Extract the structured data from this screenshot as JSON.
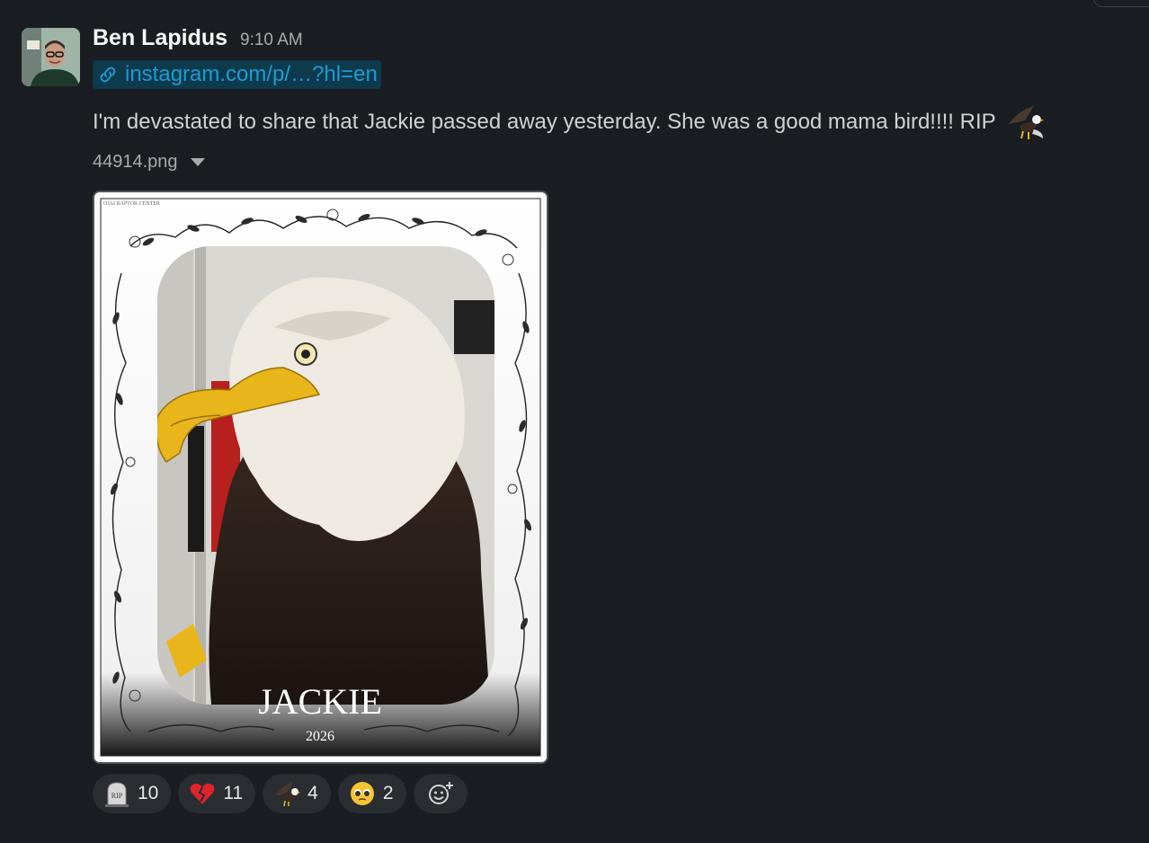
{
  "message": {
    "author": "Ben Lapidus",
    "time": "9:10 AM",
    "link_text": "instagram.com/p/…?hl=en",
    "body": "I'm devastated to share that Jackie passed away yesterday. She was a good mama bird!!!! RIP",
    "body_emoji": "eagle-emoji"
  },
  "attachment": {
    "file_name": "44914.png",
    "corner_caption": "OJAI RAPTOR CENTER",
    "caption_name": "JACKIE",
    "caption_year": "2026"
  },
  "reactions": [
    {
      "emoji": "headstone-rip",
      "count": "10"
    },
    {
      "emoji": "broken-heart",
      "count": "11"
    },
    {
      "emoji": "eagle",
      "count": "4"
    },
    {
      "emoji": "pleading-face",
      "count": "2"
    }
  ],
  "colors": {
    "background": "#1a1d21",
    "link": "#1d9bd1",
    "link_bg": "#0e3a4d",
    "reaction_bg": "#2a2d32"
  }
}
